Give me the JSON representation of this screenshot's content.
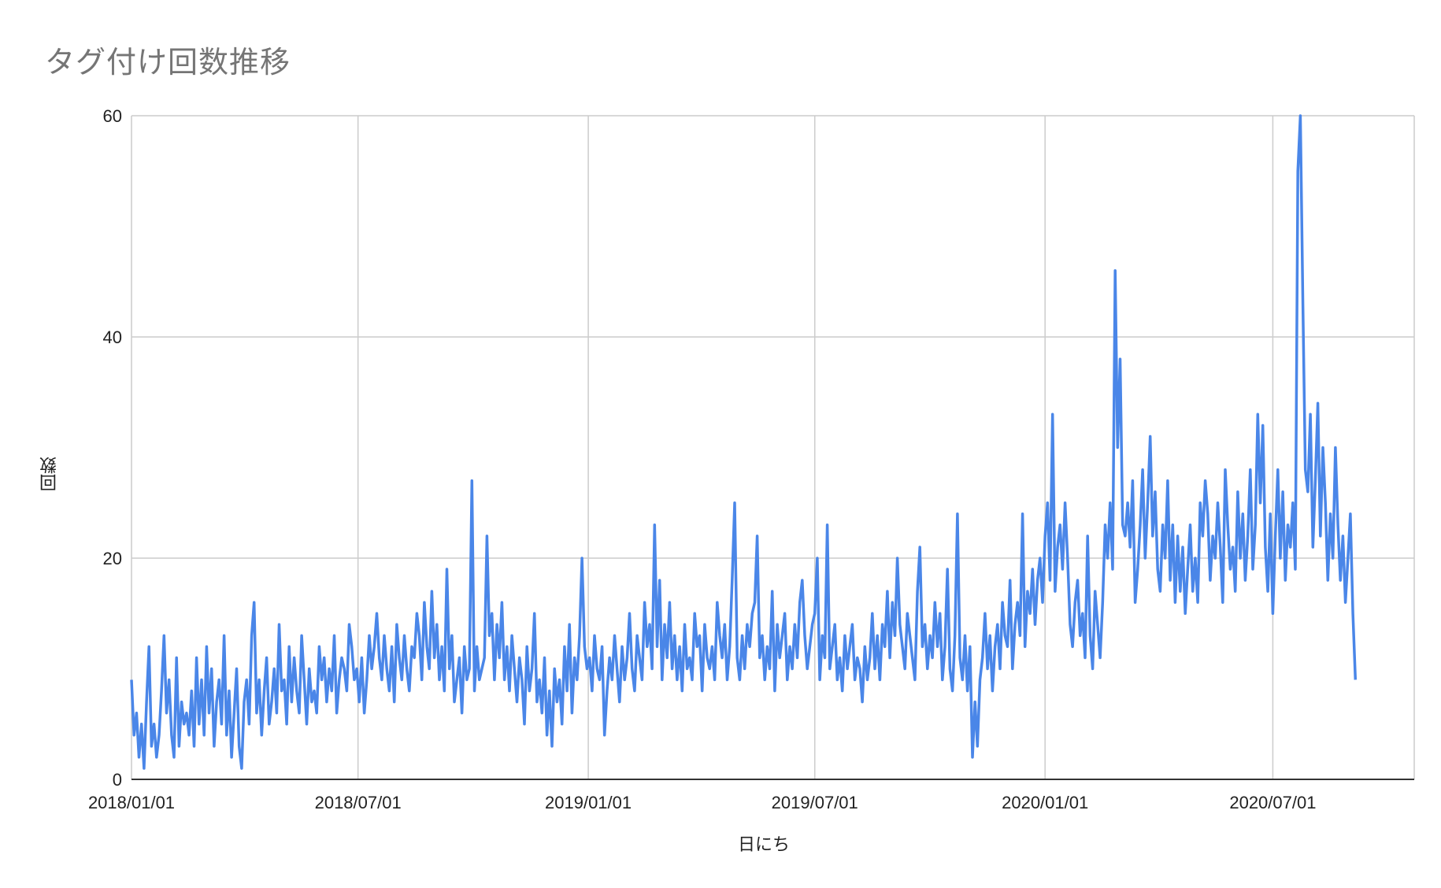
{
  "chart_data": {
    "type": "line",
    "title": "タグ付け回数推移",
    "xlabel": "日にち",
    "ylabel": "回数",
    "ylim": [
      0,
      60
    ],
    "yticks": [
      "0",
      "20",
      "40",
      "60"
    ],
    "xticks": [
      "2018/01/01",
      "2018/07/01",
      "2019/01/01",
      "2019/07/01",
      "2020/01/01",
      "2020/07/01"
    ],
    "xrange": [
      "2018/01/01",
      "2020/10/22"
    ],
    "grid": true,
    "legend": "none",
    "series": [
      {
        "color": "#4a86e8",
        "x_start": "2018/01/01",
        "x_step_days": 2,
        "values": [
          9,
          4,
          6,
          2,
          5,
          1,
          7,
          12,
          3,
          5,
          2,
          4,
          8,
          13,
          6,
          9,
          4,
          2,
          11,
          3,
          7,
          5,
          6,
          4,
          8,
          3,
          11,
          5,
          9,
          4,
          12,
          6,
          10,
          3,
          7,
          9,
          5,
          13,
          4,
          8,
          2,
          6,
          10,
          3,
          1,
          7,
          9,
          5,
          13,
          16,
          6,
          9,
          4,
          8,
          11,
          5,
          7,
          10,
          6,
          14,
          8,
          9,
          5,
          12,
          7,
          11,
          8,
          6,
          13,
          9,
          5,
          10,
          7,
          8,
          6,
          12,
          9,
          11,
          7,
          10,
          8,
          13,
          6,
          9,
          11,
          10,
          8,
          14,
          12,
          9,
          10,
          7,
          11,
          6,
          9,
          13,
          10,
          12,
          15,
          11,
          9,
          13,
          10,
          8,
          12,
          7,
          14,
          11,
          9,
          13,
          10,
          8,
          12,
          11,
          15,
          13,
          9,
          16,
          12,
          10,
          17,
          11,
          14,
          9,
          12,
          8,
          19,
          10,
          13,
          7,
          9,
          11,
          6,
          12,
          9,
          10,
          27,
          8,
          12,
          9,
          10,
          11,
          22,
          13,
          15,
          9,
          14,
          11,
          16,
          9,
          12,
          8,
          13,
          10,
          7,
          11,
          9,
          5,
          12,
          8,
          10,
          15,
          7,
          9,
          6,
          11,
          4,
          8,
          3,
          10,
          7,
          9,
          5,
          12,
          8,
          14,
          6,
          11,
          9,
          13,
          20,
          12,
          10,
          11,
          8,
          13,
          10,
          9,
          12,
          4,
          8,
          11,
          9,
          13,
          10,
          7,
          12,
          9,
          11,
          15,
          10,
          8,
          13,
          11,
          9,
          16,
          12,
          14,
          10,
          23,
          12,
          18,
          9,
          14,
          11,
          16,
          10,
          13,
          9,
          12,
          8,
          14,
          10,
          11,
          9,
          15,
          12,
          13,
          8,
          14,
          11,
          10,
          12,
          9,
          16,
          13,
          11,
          14,
          9,
          12,
          18,
          25,
          11,
          9,
          13,
          10,
          14,
          12,
          15,
          16,
          22,
          11,
          13,
          9,
          12,
          10,
          17,
          8,
          14,
          11,
          13,
          15,
          9,
          12,
          10,
          14,
          11,
          16,
          18,
          13,
          10,
          12,
          14,
          15,
          20,
          9,
          13,
          11,
          23,
          10,
          12,
          14,
          9,
          11,
          8,
          13,
          10,
          12,
          14,
          9,
          11,
          10,
          7,
          12,
          9,
          11,
          15,
          10,
          13,
          9,
          14,
          12,
          17,
          11,
          16,
          13,
          20,
          14,
          12,
          10,
          15,
          13,
          11,
          9,
          17,
          21,
          12,
          14,
          10,
          13,
          11,
          16,
          12,
          15,
          9,
          12,
          19,
          10,
          8,
          13,
          24,
          11,
          9,
          13,
          8,
          12,
          2,
          7,
          3,
          9,
          11,
          15,
          10,
          13,
          8,
          12,
          14,
          10,
          16,
          13,
          12,
          18,
          10,
          14,
          16,
          13,
          24,
          12,
          17,
          15,
          19,
          14,
          18,
          20,
          16,
          22,
          25,
          18,
          33,
          17,
          21,
          23,
          19,
          25,
          20,
          14,
          12,
          16,
          18,
          13,
          15,
          11,
          22,
          13,
          10,
          17,
          14,
          11,
          16,
          23,
          20,
          25,
          19,
          46,
          30,
          38,
          23,
          22,
          25,
          21,
          27,
          16,
          19,
          23,
          28,
          20,
          25,
          31,
          22,
          26,
          19,
          17,
          23,
          20,
          27,
          18,
          23,
          16,
          22,
          17,
          21,
          15,
          19,
          23,
          17,
          20,
          16,
          25,
          22,
          27,
          24,
          18,
          22,
          20,
          25,
          21,
          16,
          28,
          23,
          19,
          21,
          17,
          26,
          20,
          24,
          18,
          22,
          28,
          19,
          23,
          33,
          25,
          32,
          21,
          17,
          24,
          15,
          22,
          28,
          20,
          26,
          18,
          23,
          21,
          25,
          19,
          55,
          60,
          43,
          28,
          26,
          33,
          21,
          27,
          34,
          22,
          30,
          25,
          18,
          24,
          20,
          30,
          23,
          18,
          22,
          16,
          20,
          24,
          15,
          9
        ]
      }
    ]
  }
}
